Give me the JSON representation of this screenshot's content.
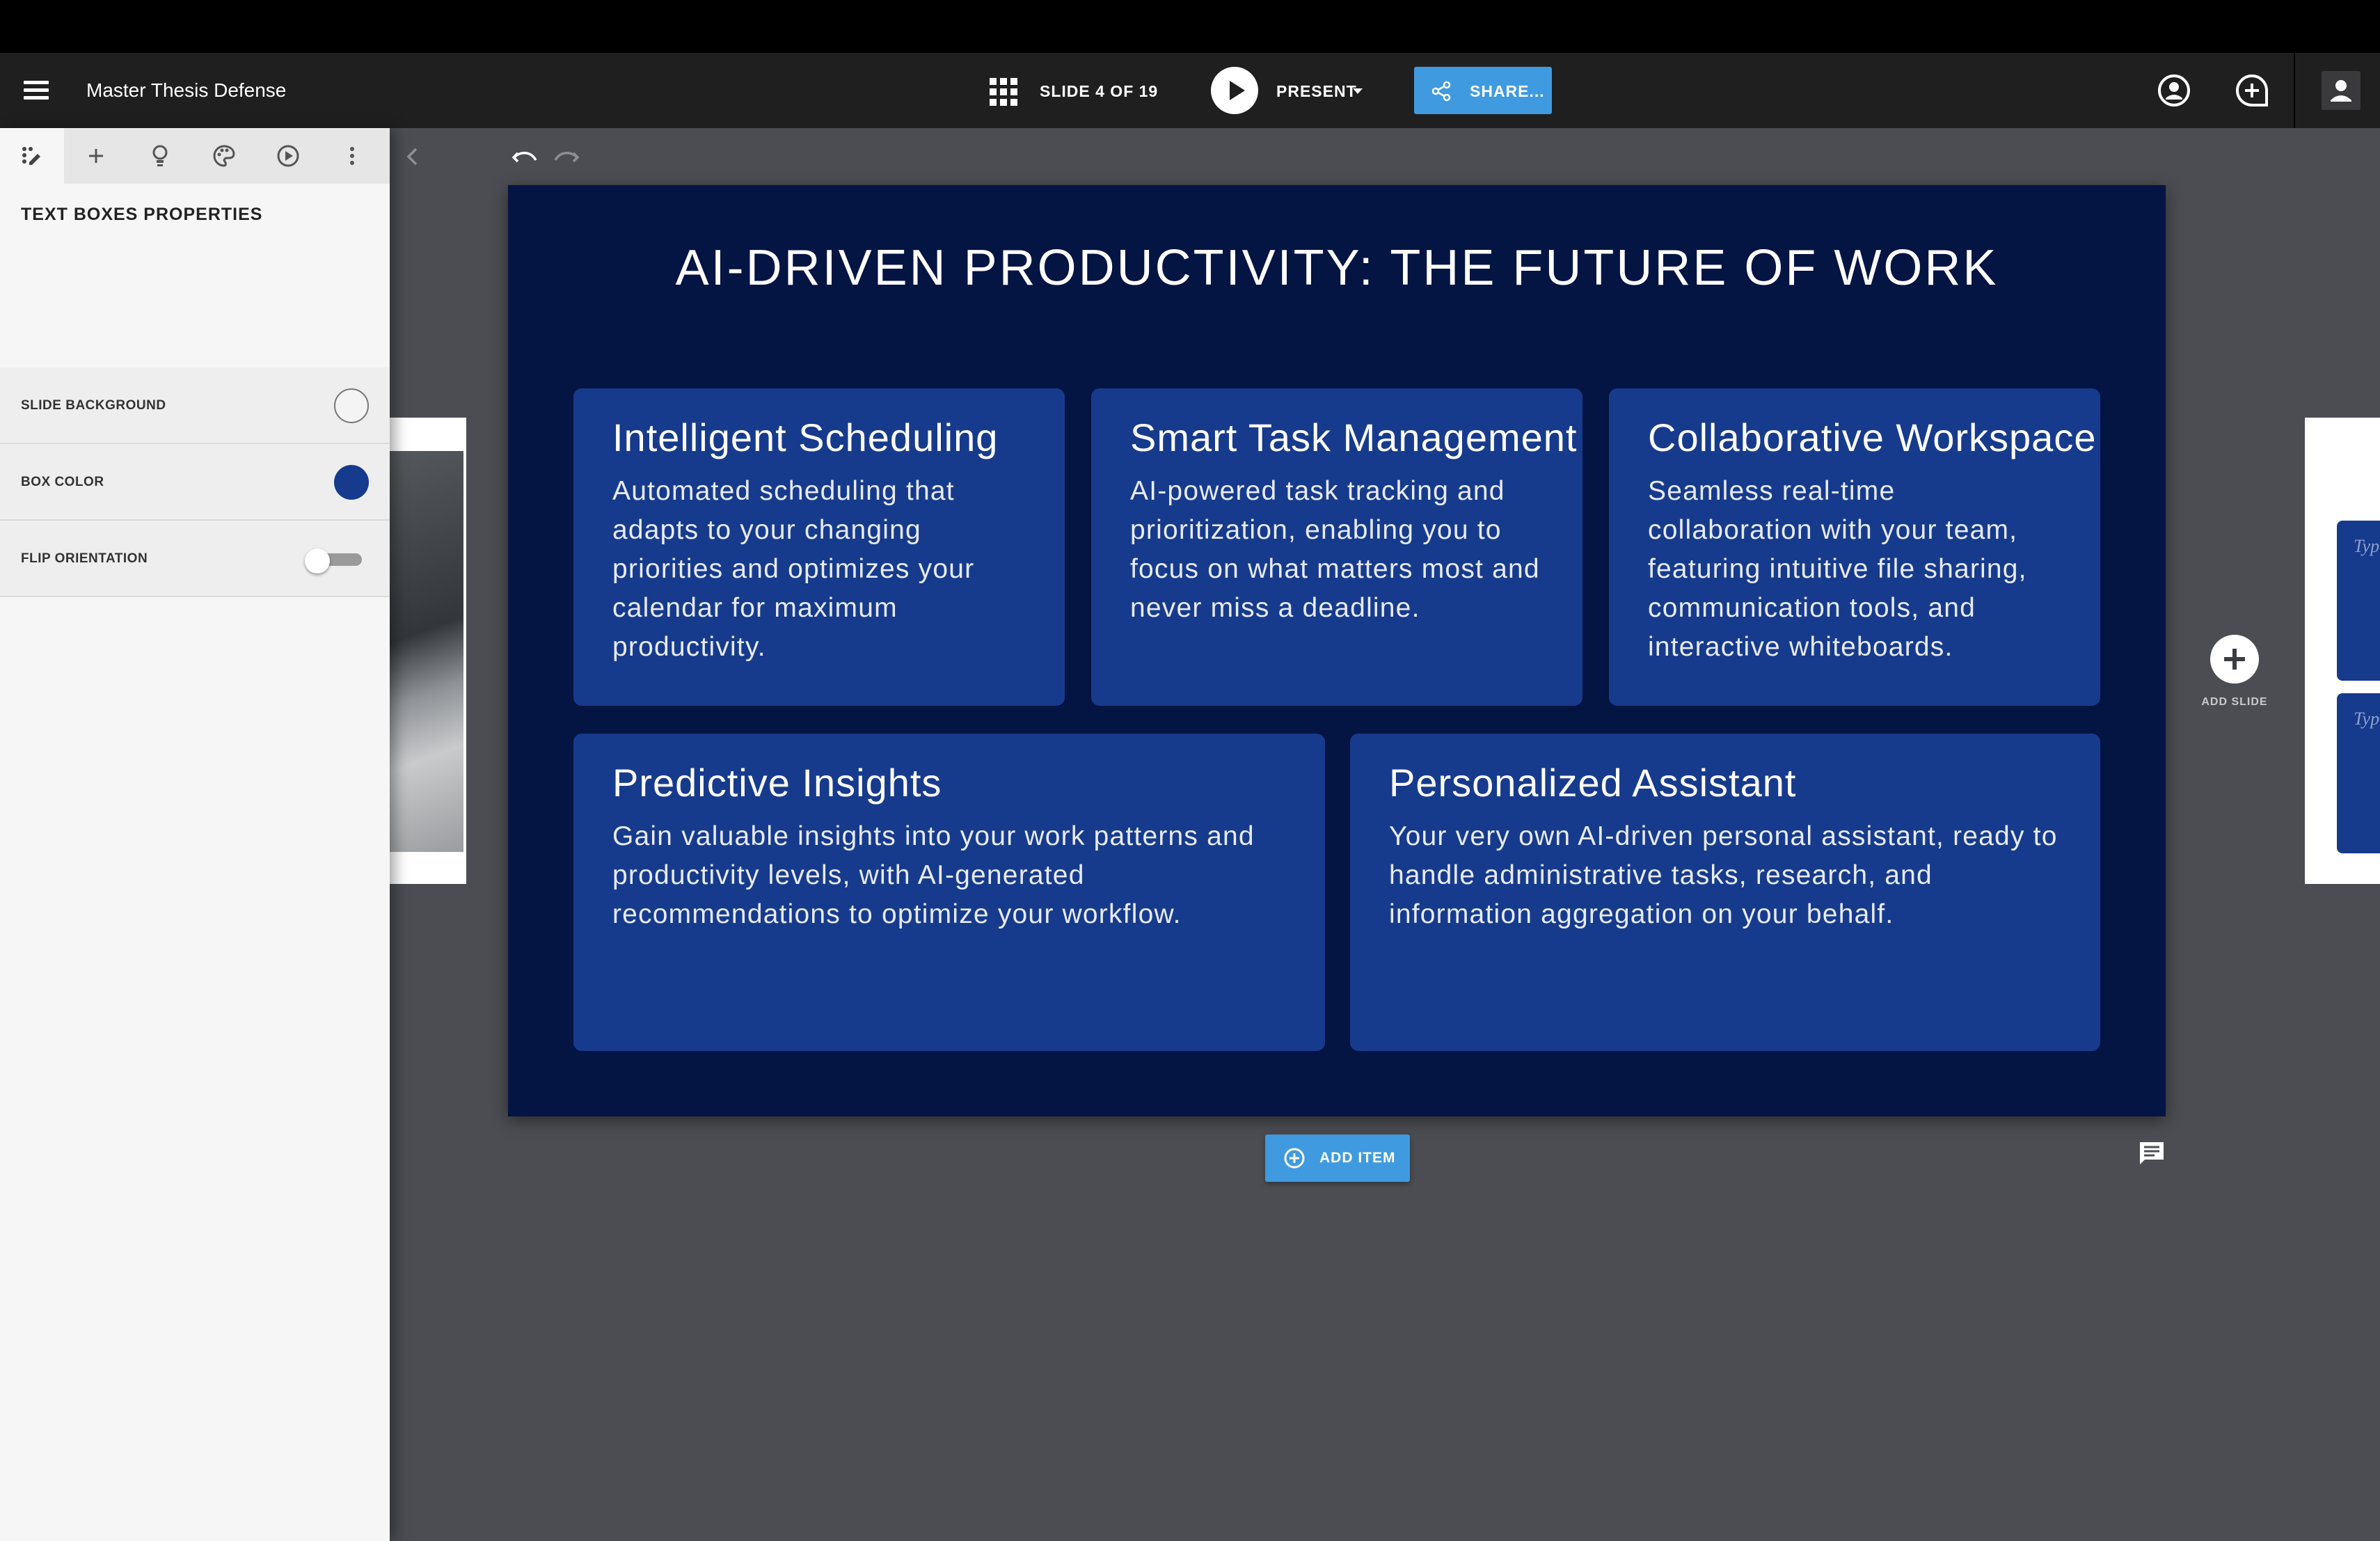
{
  "header": {
    "document_title": "Master Thesis Defense",
    "slide_counter": "SLIDE 4 OF 19",
    "present_label": "PRESENT",
    "share_label": "SHARE..."
  },
  "left_panel": {
    "tools": [
      "layout-icon",
      "add-icon",
      "lightbulb-icon",
      "palette-icon",
      "play-circle-icon",
      "more-vertical-icon"
    ],
    "heading": "TEXT BOXES PROPERTIES",
    "properties": [
      {
        "label": "SLIDE BACKGROUND",
        "control": "color-swatch",
        "value": "#f4f4f4"
      },
      {
        "label": "BOX COLOR",
        "control": "color-swatch",
        "value": "#163a8c"
      },
      {
        "label": "FLIP ORIENTATION",
        "control": "toggle",
        "value": "off"
      }
    ]
  },
  "slide": {
    "title": "AI-DRIVEN PRODUCTIVITY: THE FUTURE OF WORK",
    "background_color": "#041443",
    "box_color": "#173b8c",
    "cards": [
      {
        "title": "Intelligent Scheduling",
        "body": "Automated scheduling that adapts to your changing priorities and optimizes your calendar for maximum productivity."
      },
      {
        "title": "Smart Task Management",
        "body": "AI-powered task tracking and prioritization, enabling you to focus on what matters most and never miss a deadline."
      },
      {
        "title": "Collaborative Workspace",
        "body": "Seamless real-time collaboration with your team, featuring intuitive file sharing, communication tools, and interactive whiteboards."
      },
      {
        "title": "Predictive Insights",
        "body": "Gain valuable insights into your work patterns and productivity levels, with AI-generated recommendations to optimize your workflow."
      },
      {
        "title": "Personalized Assistant",
        "body": "Your very own AI-driven personal assistant, ready to handle administrative tasks, research, and information aggregation on your behalf."
      }
    ]
  },
  "canvas": {
    "add_slide_label": "ADD SLIDE",
    "add_item_label": "ADD ITEM",
    "next_thumb_placeholder": "Typ"
  },
  "colors": {
    "accent": "#3f9ae0",
    "header_bg": "#1f1f20",
    "canvas_bg": "#4c4d52"
  }
}
